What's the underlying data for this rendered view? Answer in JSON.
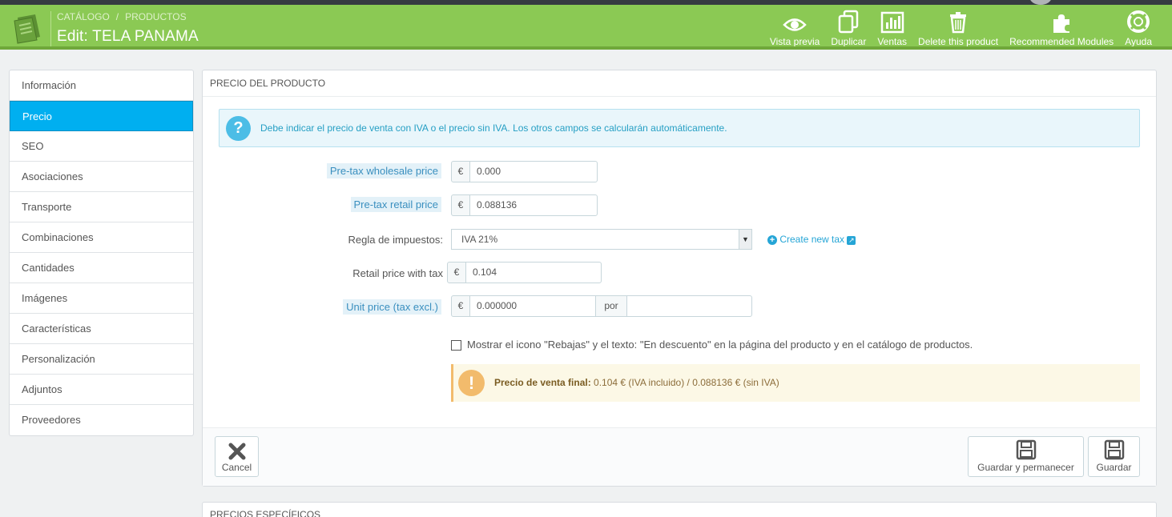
{
  "header": {
    "breadcrumb": [
      "CATÁLOGO",
      "PRODUCTOS"
    ],
    "breadcrumb_sep": "/",
    "title": "Edit: TELA PANAMA",
    "toolbar": [
      {
        "label": "Vista previa",
        "icon": "eye-icon"
      },
      {
        "label": "Duplicar",
        "icon": "copy-icon"
      },
      {
        "label": "Ventas",
        "icon": "bar-chart-icon"
      },
      {
        "label": "Delete this product",
        "icon": "trash-icon"
      },
      {
        "label": "Recommended Modules",
        "icon": "puzzle-icon"
      },
      {
        "label": "Ayuda",
        "icon": "lifebuoy-icon"
      }
    ]
  },
  "sidebar": {
    "items": [
      {
        "label": "Información"
      },
      {
        "label": "Precio",
        "active": true
      },
      {
        "label": "SEO"
      },
      {
        "label": "Asociaciones"
      },
      {
        "label": "Transporte"
      },
      {
        "label": "Combinaciones"
      },
      {
        "label": "Cantidades"
      },
      {
        "label": "Imágenes"
      },
      {
        "label": "Características"
      },
      {
        "label": "Personalización"
      },
      {
        "label": "Adjuntos"
      },
      {
        "label": "Proveedores"
      }
    ]
  },
  "panel": {
    "heading": "PRECIO DEL PRODUCTO",
    "info": "Debe indicar el precio de venta con IVA o el precio sin IVA. Los otros campos se calcularán automáticamente.",
    "currency": "€",
    "wholesale": {
      "label": "Pre-tax wholesale price",
      "value": "0.000"
    },
    "retail": {
      "label": "Pre-tax retail price",
      "value": "0.088136"
    },
    "tax_rule": {
      "label": "Regla de impuestos:",
      "value": "IVA 21%",
      "create_link": "Create new tax"
    },
    "retail_with_tax": {
      "label": "Retail price with tax",
      "value": "0.104"
    },
    "unit_price": {
      "label": "Unit price (tax excl.)",
      "value": "0.000000",
      "per_label": "por",
      "per_value": ""
    },
    "on_sale_label": "Mostrar el icono \"Rebajas\" y el texto: \"En descuento\" en la página del producto y en el catálogo de productos.",
    "on_sale_checked": false,
    "final_price_label": "Precio de venta final:",
    "final_price_text": "0.104 € (IVA incluido) / 0.088136 € (sin IVA)",
    "footer": {
      "cancel": "Cancel",
      "save_stay": "Guardar y permanecer",
      "save": "Guardar"
    }
  },
  "panel2": {
    "heading": "PRECIOS ESPECÍFICOS"
  },
  "colors": {
    "header_green": "#8bc954",
    "active_blue": "#00aff0",
    "info_text": "#259fc4",
    "warning": "#f2bb6c"
  }
}
